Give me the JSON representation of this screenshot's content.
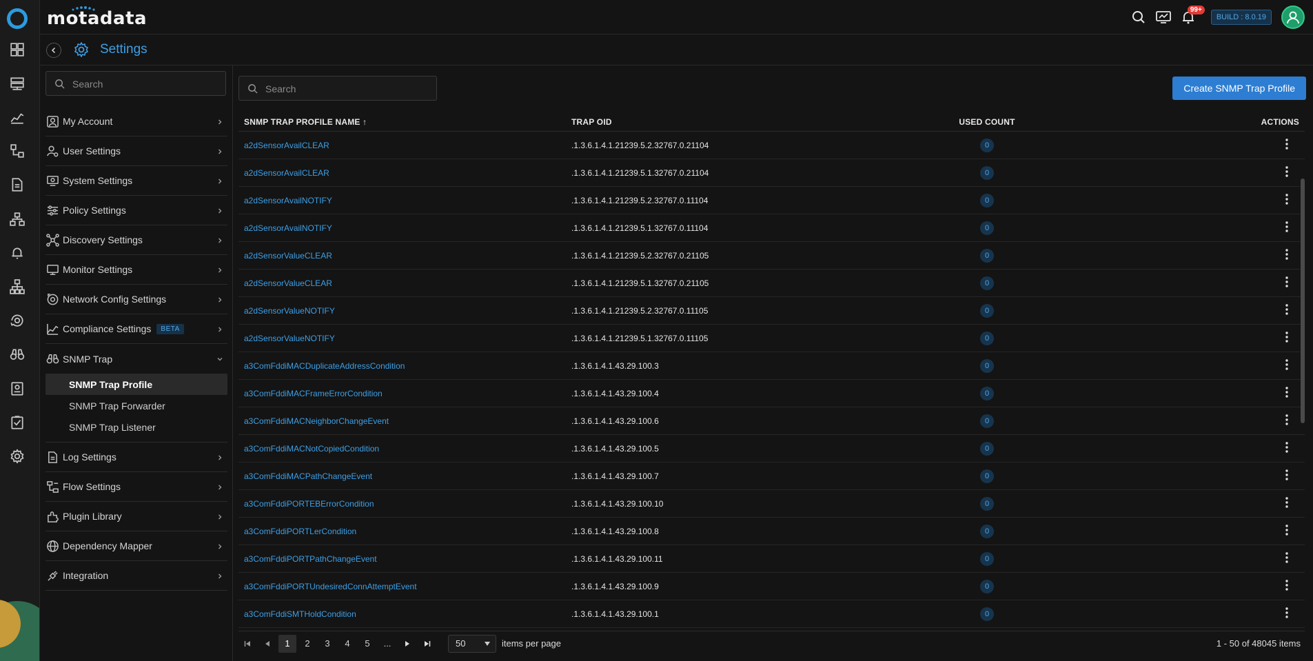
{
  "rail": {
    "icons": [
      "dashboard-icon",
      "inventory-icon",
      "metrics-icon",
      "topology-icon",
      "reports-icon",
      "network-icon",
      "alerts-icon",
      "hierarchy-icon",
      "ai-ops-icon",
      "binoculars-icon",
      "audit-icon",
      "checklist-icon",
      "settings-icon"
    ]
  },
  "topbar": {
    "brand": "motadata",
    "notifications": "99+",
    "build": "BUILD : 8.0.19"
  },
  "header": {
    "title": "Settings"
  },
  "nav": {
    "search_placeholder": "Search",
    "items_top": [
      {
        "label": "My Account",
        "icon": "user-icon"
      },
      {
        "label": "User Settings",
        "icon": "users-gear-icon"
      },
      {
        "label": "System Settings",
        "icon": "system-icon"
      },
      {
        "label": "Policy Settings",
        "icon": "sliders-icon"
      },
      {
        "label": "Discovery Settings",
        "icon": "discovery-icon"
      },
      {
        "label": "Monitor Settings",
        "icon": "monitor-icon"
      },
      {
        "label": "Network Config Settings",
        "icon": "network-config-icon"
      },
      {
        "label": "Compliance Settings",
        "icon": "compliance-icon",
        "badge": "BETA"
      },
      {
        "label": "SNMP Trap",
        "icon": "binoculars-icon"
      }
    ],
    "snmp_sub": [
      "SNMP Trap Profile",
      "SNMP Trap Forwarder",
      "SNMP Trap Listener"
    ],
    "items_bottom": [
      {
        "label": "Log Settings",
        "icon": "log-icon"
      },
      {
        "label": "Flow Settings",
        "icon": "flow-icon"
      },
      {
        "label": "Plugin Library",
        "icon": "plugin-icon"
      },
      {
        "label": "Dependency Mapper",
        "icon": "globe-icon"
      },
      {
        "label": "Integration",
        "icon": "plug-icon"
      }
    ]
  },
  "main": {
    "search_placeholder": "Search",
    "create_label": "Create SNMP Trap Profile",
    "columns": {
      "name": "SNMP TRAP PROFILE NAME ↑",
      "oid": "TRAP OID",
      "count": "USED COUNT",
      "actions": "ACTIONS"
    },
    "rows": [
      {
        "name": "a2dSensorAvailCLEAR",
        "oid": ".1.3.6.1.4.1.21239.5.2.32767.0.21104",
        "count": "0"
      },
      {
        "name": "a2dSensorAvailCLEAR",
        "oid": ".1.3.6.1.4.1.21239.5.1.32767.0.21104",
        "count": "0"
      },
      {
        "name": "a2dSensorAvailNOTIFY",
        "oid": ".1.3.6.1.4.1.21239.5.2.32767.0.11104",
        "count": "0"
      },
      {
        "name": "a2dSensorAvailNOTIFY",
        "oid": ".1.3.6.1.4.1.21239.5.1.32767.0.11104",
        "count": "0"
      },
      {
        "name": "a2dSensorValueCLEAR",
        "oid": ".1.3.6.1.4.1.21239.5.2.32767.0.21105",
        "count": "0"
      },
      {
        "name": "a2dSensorValueCLEAR",
        "oid": ".1.3.6.1.4.1.21239.5.1.32767.0.21105",
        "count": "0"
      },
      {
        "name": "a2dSensorValueNOTIFY",
        "oid": ".1.3.6.1.4.1.21239.5.2.32767.0.11105",
        "count": "0"
      },
      {
        "name": "a2dSensorValueNOTIFY",
        "oid": ".1.3.6.1.4.1.21239.5.1.32767.0.11105",
        "count": "0"
      },
      {
        "name": "a3ComFddiMACDuplicateAddressCondition",
        "oid": ".1.3.6.1.4.1.43.29.100.3",
        "count": "0"
      },
      {
        "name": "a3ComFddiMACFrameErrorCondition",
        "oid": ".1.3.6.1.4.1.43.29.100.4",
        "count": "0"
      },
      {
        "name": "a3ComFddiMACNeighborChangeEvent",
        "oid": ".1.3.6.1.4.1.43.29.100.6",
        "count": "0"
      },
      {
        "name": "a3ComFddiMACNotCopiedCondition",
        "oid": ".1.3.6.1.4.1.43.29.100.5",
        "count": "0"
      },
      {
        "name": "a3ComFddiMACPathChangeEvent",
        "oid": ".1.3.6.1.4.1.43.29.100.7",
        "count": "0"
      },
      {
        "name": "a3ComFddiPORTEBErrorCondition",
        "oid": ".1.3.6.1.4.1.43.29.100.10",
        "count": "0"
      },
      {
        "name": "a3ComFddiPORTLerCondition",
        "oid": ".1.3.6.1.4.1.43.29.100.8",
        "count": "0"
      },
      {
        "name": "a3ComFddiPORTPathChangeEvent",
        "oid": ".1.3.6.1.4.1.43.29.100.11",
        "count": "0"
      },
      {
        "name": "a3ComFddiPORTUndesiredConnAttemptEvent",
        "oid": ".1.3.6.1.4.1.43.29.100.9",
        "count": "0"
      },
      {
        "name": "a3ComFddiSMTHoldCondition",
        "oid": ".1.3.6.1.4.1.43.29.100.1",
        "count": "0"
      }
    ],
    "pager": {
      "pages": [
        "1",
        "2",
        "3",
        "4",
        "5",
        "..."
      ],
      "current": "1",
      "per_page": "50",
      "per_page_label": "items per page",
      "total": "1 - 50 of 48045 items"
    }
  }
}
